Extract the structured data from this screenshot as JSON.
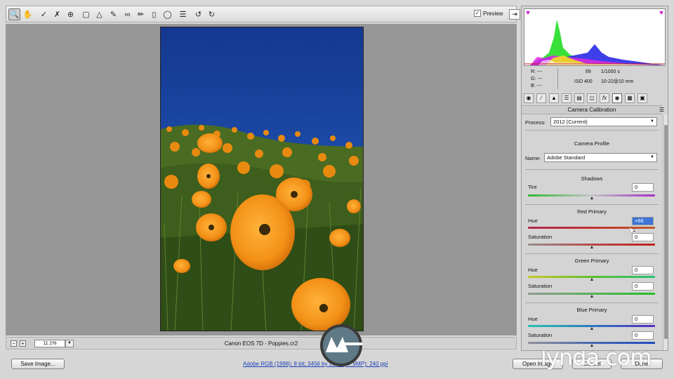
{
  "toolbar": {
    "tools": [
      "zoom-tool-icon",
      "hand-tool-icon",
      "white-balance-tool-icon",
      "color-sampler-tool-icon",
      "targeted-adjustment-tool-icon",
      "crop-tool-icon",
      "straighten-tool-icon",
      "spot-removal-tool-icon",
      "red-eye-removal-tool-icon",
      "adjustment-brush-icon",
      "graduated-filter-icon",
      "radial-filter-icon",
      "preferences-icon",
      "rotate-left-icon",
      "rotate-right-icon"
    ],
    "preview_label": "Preview",
    "preview_checked": "✓"
  },
  "status": {
    "zoom_level": "11.1%",
    "filename": "Canon EOS 7D  -  Poppies.cr2",
    "workflow_link": "Adobe RGB (1998); 8 bit; 3456 by 5184 (17.9MP); 240 ppi"
  },
  "buttons": {
    "save_image": "Save Image...",
    "open_image": "Open Image",
    "cancel": "Cancel",
    "done": "Done"
  },
  "watermark": {
    "brand": "lynda.com"
  },
  "readout": {
    "r": "R:  ---",
    "g": "G:  ---",
    "b": "B:  ---",
    "aperture": "f/8",
    "shutter": "1/1000 s",
    "iso": "ISO 400",
    "lens": "10-22@10 mm"
  },
  "panel": {
    "title": "Camera Calibration",
    "process_label": "Process:",
    "process_value": "2012 (Current)",
    "camera_profile_title": "Camera Profile",
    "name_label": "Name:",
    "name_value": "Adobe Standard",
    "shadows": {
      "title": "Shadows",
      "tint_label": "Tint",
      "tint_value": "0"
    },
    "red_primary": {
      "title": "Red Primary",
      "hue_label": "Hue",
      "hue_value": "+66",
      "sat_label": "Saturation",
      "sat_value": "0"
    },
    "green_primary": {
      "title": "Green Primary",
      "hue_label": "Hue",
      "hue_value": "0",
      "sat_label": "Saturation",
      "sat_value": "0"
    },
    "blue_primary": {
      "title": "Blue Primary",
      "hue_label": "Hue",
      "hue_value": "0",
      "sat_label": "Saturation",
      "sat_value": "0"
    }
  },
  "slider_levels": {
    "tint": 0.5,
    "red_hue": 0.83,
    "red_sat": 0.5,
    "green_hue": 0.5,
    "green_sat": 0.5,
    "blue_hue": 0.5,
    "blue_sat": 0.5
  },
  "colors": {
    "accent_selection": "#3d74d6",
    "link": "#1a3fb8"
  }
}
